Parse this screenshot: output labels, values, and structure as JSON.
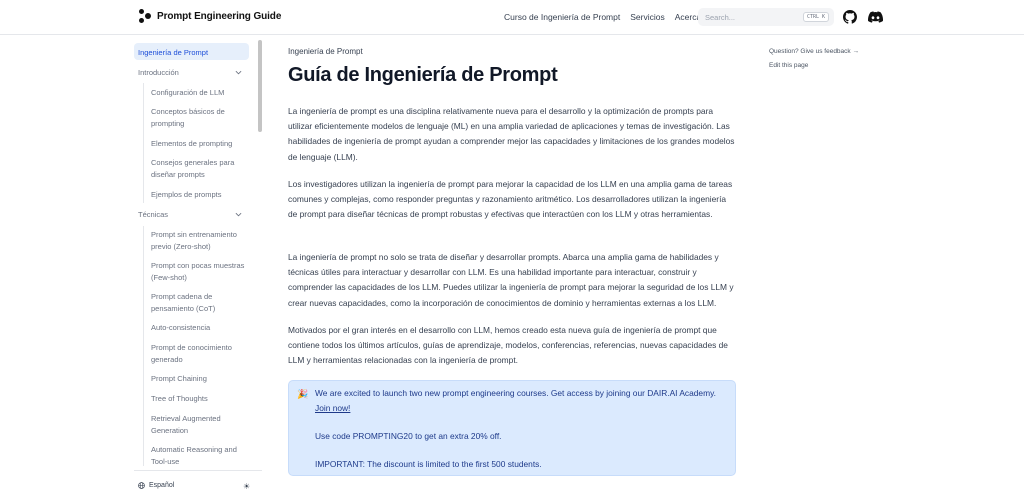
{
  "header": {
    "logo_text": "Prompt Engineering Guide",
    "nav": [
      "Curso de Ingeniería de Prompt",
      "Servicios",
      "Acerca de"
    ],
    "search_placeholder": "Search...",
    "search_shortcut": "CTRL K",
    "icons": [
      "github-icon",
      "discord-icon"
    ]
  },
  "sidebar": {
    "items": [
      {
        "label": "Ingeniería de Prompt",
        "level": 0,
        "active": true
      },
      {
        "label": "Introducción",
        "level": 0,
        "expanded": true
      },
      {
        "label": "Configuración de LLM",
        "level": 1
      },
      {
        "label": "Conceptos básicos de prompting",
        "level": 1
      },
      {
        "label": "Elementos de prompting",
        "level": 1
      },
      {
        "label": "Consejos generales para diseñar prompts",
        "level": 1
      },
      {
        "label": "Ejemplos de prompts",
        "level": 1
      },
      {
        "label": "Técnicas",
        "level": 0,
        "expanded": true
      },
      {
        "label": "Prompt sin entrenamiento previo (Zero-shot)",
        "level": 1
      },
      {
        "label": "Prompt con pocas muestras (Few-shot)",
        "level": 1
      },
      {
        "label": "Prompt cadena de pensamiento (CoT)",
        "level": 1
      },
      {
        "label": "Auto-consistencia",
        "level": 1
      },
      {
        "label": "Prompt de conocimiento generado",
        "level": 1
      },
      {
        "label": "Prompt Chaining",
        "level": 1
      },
      {
        "label": "Tree of Thoughts",
        "level": 1
      },
      {
        "label": "Retrieval Augmented Generation",
        "level": 1
      },
      {
        "label": "Automatic Reasoning and Tool-use",
        "level": 1
      }
    ],
    "footer": {
      "language": "Español",
      "theme_icon": "sun-icon"
    }
  },
  "main": {
    "breadcrumb": "Ingeniería de Prompt",
    "title": "Guía de Ingeniería de Prompt",
    "paragraphs": [
      "La ingeniería de prompt es una disciplina relativamente nueva para el desarrollo y la optimización de prompts para utilizar eficientemente modelos de lenguaje (ML) en una amplia variedad de aplicaciones y temas de investigación. Las habilidades de ingeniería de prompt ayudan a comprender mejor las capacidades y limitaciones de los grandes modelos de lenguaje (LLM).",
      "Los investigadores utilizan la ingeniería de prompt para mejorar la capacidad de los LLM en una amplia gama de tareas comunes y complejas, como responder preguntas y razonamiento aritmético. Los desarrolladores utilizan la ingeniería de prompt para diseñar técnicas de prompt robustas y efectivas que interactúen con los LLM y otras herramientas.",
      "La ingeniería de prompt no solo se trata de diseñar y desarrollar prompts. Abarca una amplia gama de habilidades y técnicas útiles para interactuar y desarrollar con LLM. Es una habilidad importante para interactuar, construir y comprender las capacidades de los LLM. Puedes utilizar la ingeniería de prompt para mejorar la seguridad de los LLM y crear nuevas capacidades, como la incorporación de conocimientos de dominio y herramientas externas a los LLM.",
      "Motivados por el gran interés en el desarrollo con LLM, hemos creado esta nueva guía de ingeniería de prompt que contiene todos los últimos artículos, guías de aprendizaje, modelos, conferencias, referencias, nuevas capacidades de LLM y herramientas relacionadas con la ingeniería de prompt."
    ],
    "callout": {
      "icon": "🎉",
      "text": "We are excited to launch two new prompt engineering courses. Get access by joining our DAIR.AI Academy.",
      "link": "Join now!",
      "code_text": "Use code PROMPTING20 to get an extra 20% off.",
      "important": "IMPORTANT: The discount is limited to the first 500 students."
    }
  },
  "toc": {
    "feedback": "Question? Give us feedback →",
    "edit": "Edit this page"
  },
  "colors": {
    "accent": "#1d4ed8",
    "active_bg": "#e6effb",
    "callout_bg": "#dbeafe",
    "callout_text": "#1e3a8a"
  }
}
